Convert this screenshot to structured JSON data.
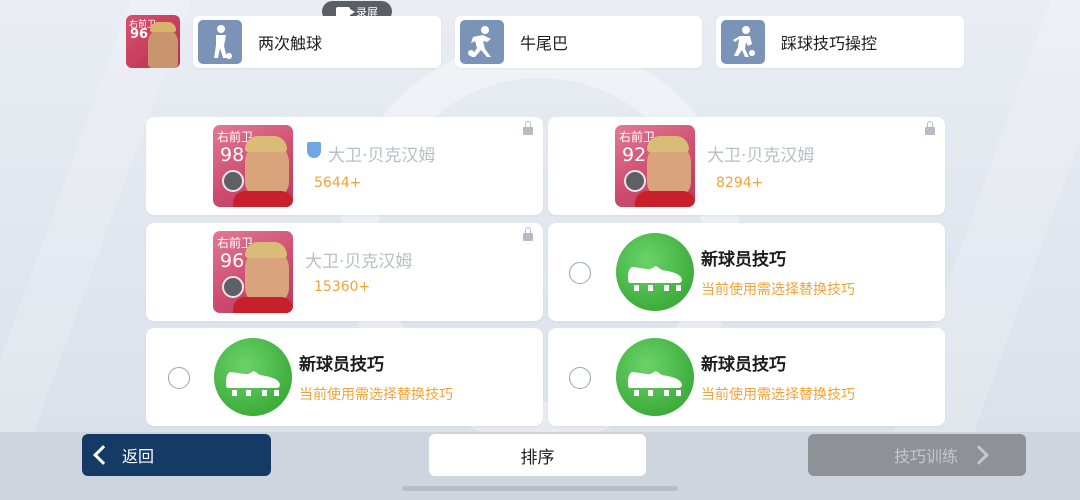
{
  "recording": {
    "label": "录屏"
  },
  "current_player": {
    "position": "右前卫",
    "rating": "96"
  },
  "skill_tabs": [
    {
      "label": "两次触球",
      "icon": "player-double-touch-icon"
    },
    {
      "label": "牛尾巴",
      "icon": "player-elastico-icon"
    },
    {
      "label": "踩球技巧操控",
      "icon": "player-sole-control-icon"
    }
  ],
  "player_cards": [
    {
      "position": "右前卫",
      "rating": "98",
      "name": "大卫·贝克汉姆",
      "cost": "5644+",
      "verified": true,
      "locked": true
    },
    {
      "position": "右前卫",
      "rating": "92",
      "name": "大卫·贝克汉姆",
      "cost": "8294+",
      "verified": false,
      "locked": true
    },
    {
      "position": "右前卫",
      "rating": "96",
      "name": "大卫·贝克汉姆",
      "cost": "15360+",
      "verified": false,
      "locked": true
    }
  ],
  "new_skill_slots": [
    {
      "title": "新球员技巧",
      "subtitle": "当前使用需选择替换技巧"
    },
    {
      "title": "新球员技巧",
      "subtitle": "当前使用需选择替换技巧"
    },
    {
      "title": "新球员技巧",
      "subtitle": "当前使用需选择替换技巧"
    }
  ],
  "buttons": {
    "back": "返回",
    "sort": "排序",
    "train": "技巧训练"
  },
  "colors": {
    "accent_orange": "#f0a438",
    "back_button": "#163a66",
    "card_pink": "#cf4c70",
    "boot_green": "#3eae3c"
  }
}
